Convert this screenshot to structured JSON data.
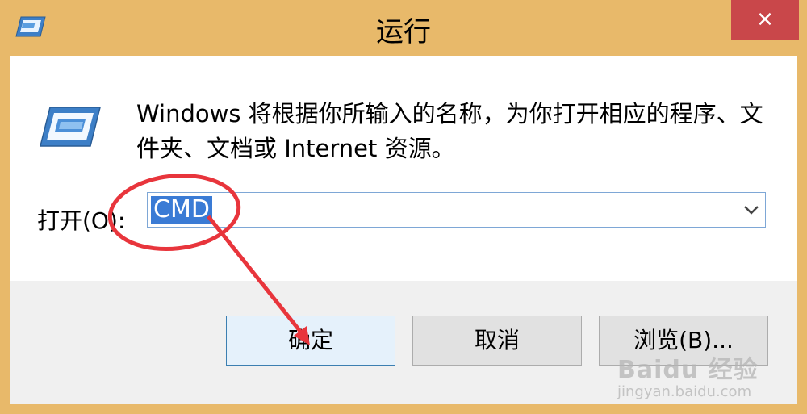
{
  "window": {
    "title": "运行",
    "close_glyph": "✕"
  },
  "dialog": {
    "description": "Windows 将根据你所输入的名称，为你打开相应的程序、文件夹、文档或 Internet 资源。",
    "open_label": "打开(O):",
    "command_value": "CMD"
  },
  "buttons": {
    "ok": "确定",
    "cancel": "取消",
    "browse": "浏览(B)..."
  },
  "watermark": {
    "main": "Baidu 经验",
    "sub": "jingyan.baidu.com"
  },
  "icons": [
    "run-icon",
    "chevron-down-icon",
    "close-icon"
  ],
  "colors": {
    "frame": "#e8b96a",
    "close": "#c9474a",
    "selection": "#3a7bd5",
    "annotation": "#e8353c"
  }
}
